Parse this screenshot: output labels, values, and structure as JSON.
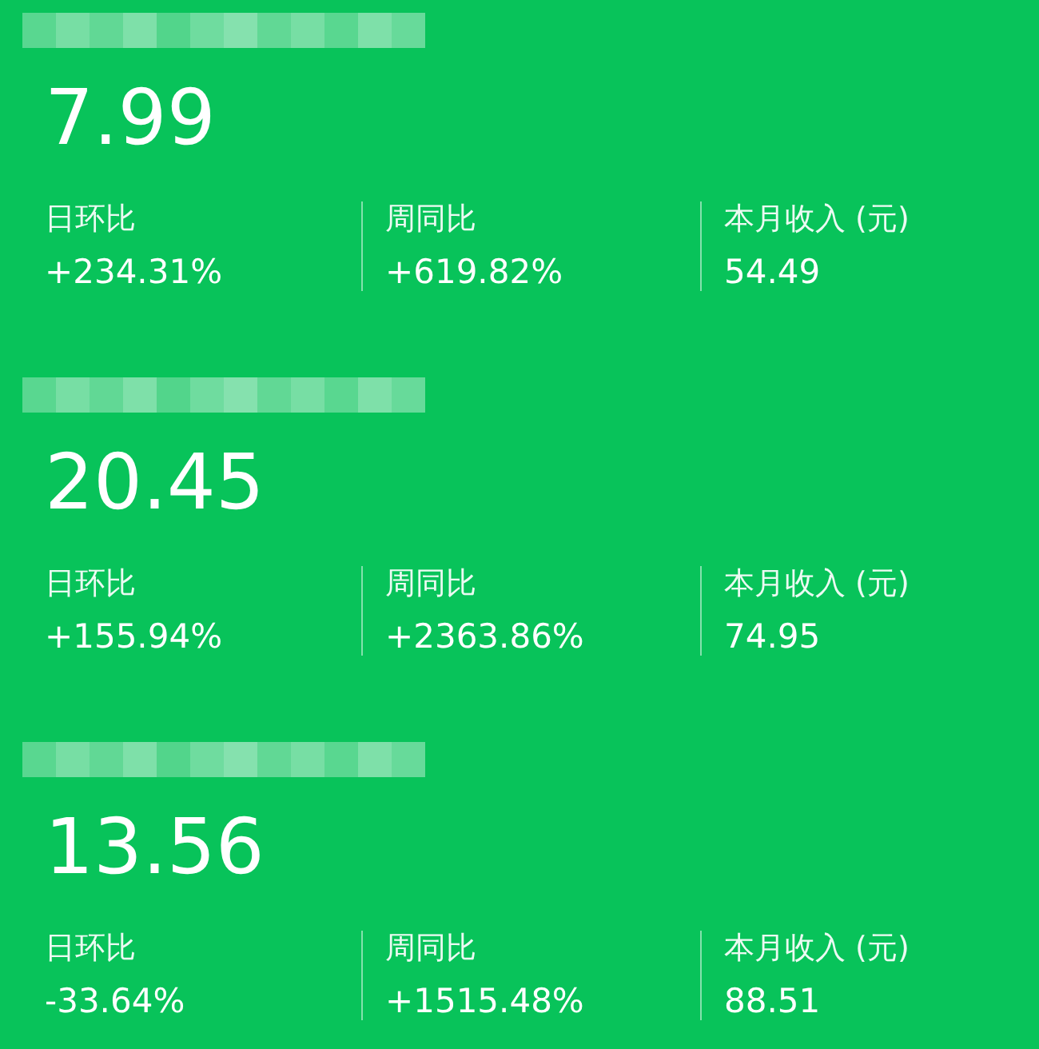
{
  "cards": [
    {
      "value": "7.99",
      "stats": [
        {
          "label": "日环比",
          "value": "+234.31%"
        },
        {
          "label": "周同比",
          "value": "+619.82%"
        },
        {
          "label": "本月收入 (元)",
          "value": "54.49"
        }
      ]
    },
    {
      "value": "20.45",
      "stats": [
        {
          "label": "日环比",
          "value": "+155.94%"
        },
        {
          "label": "周同比",
          "value": "+2363.86%"
        },
        {
          "label": "本月收入 (元)",
          "value": "74.95"
        }
      ]
    },
    {
      "value": "13.56",
      "stats": [
        {
          "label": "日环比",
          "value": "-33.64%"
        },
        {
          "label": "周同比",
          "value": "+1515.48%"
        },
        {
          "label": "本月收入 (元)",
          "value": "88.51"
        }
      ]
    }
  ]
}
